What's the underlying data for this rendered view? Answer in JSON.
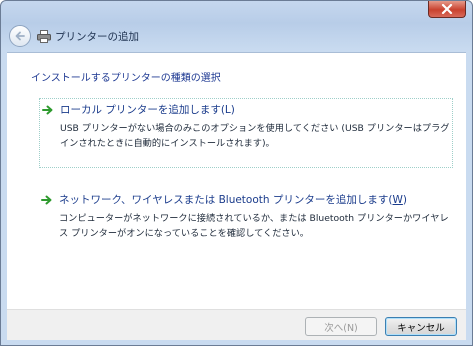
{
  "window": {
    "title": "プリンターの追加"
  },
  "page": {
    "heading": "インストールするプリンターの種類の選択"
  },
  "options": [
    {
      "title": "ローカル プリンターを追加します(L)",
      "description": "USB プリンターがない場合のみこのオプションを使用してください (USB プリンターはプラグインされたときに自動的にインストールされます)。",
      "icon": "green-arrow-icon"
    },
    {
      "title_prefix": "ネットワーク、ワイヤレスまたは Bluetooth プリンターを追加します(",
      "title_key": "W",
      "title_suffix": ")",
      "description": "コンピューターがネットワークに接続されているか、または Bluetooth プリンターかワイヤレス プリンターがオンになっていることを確認してください。",
      "icon": "green-arrow-icon"
    }
  ],
  "buttons": {
    "next": "次へ(N)",
    "cancel": "キャンセル"
  },
  "colors": {
    "accent_text": "#1b3c8c",
    "close_button": "#c9422f",
    "frame": "#b8cde8"
  }
}
